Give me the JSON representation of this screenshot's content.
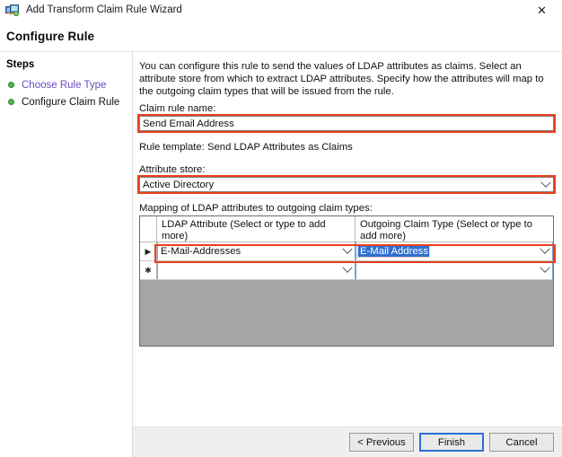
{
  "window": {
    "title": "Add Transform Claim Rule Wizard",
    "icon": "wizard-icon",
    "close_label": "✕"
  },
  "page": {
    "heading": "Configure Rule",
    "description": "You can configure this rule to send the values of LDAP attributes as claims. Select an attribute store from which to extract LDAP attributes. Specify how the attributes will map to the outgoing claim types that will be issued from the rule."
  },
  "steps": {
    "title": "Steps",
    "items": [
      {
        "label": "Choose Rule Type",
        "state": "link"
      },
      {
        "label": "Configure Claim Rule",
        "state": "current"
      }
    ]
  },
  "form": {
    "claim_rule_name_label": "Claim rule name:",
    "claim_rule_name_value": "Send Email Address",
    "claim_rule_name_placeholder": "",
    "rule_template_label": "Rule template: Send LDAP Attributes as Claims",
    "attribute_store_label": "Attribute store:",
    "attribute_store_value": "Active Directory",
    "attribute_store_options": [
      "Active Directory"
    ],
    "mapping_label": "Mapping of LDAP attributes to outgoing claim types:"
  },
  "grid": {
    "columns": [
      "LDAP Attribute (Select or type to add more)",
      "Outgoing Claim Type (Select or type to add more)"
    ],
    "rows": [
      {
        "indicator": "▶",
        "ldap_attribute": "E-Mail-Addresses",
        "outgoing_claim_type": "E-Mail Address",
        "claim_selected": true
      },
      {
        "indicator": "✱",
        "ldap_attribute": "",
        "outgoing_claim_type": "",
        "claim_selected": false
      }
    ]
  },
  "footer": {
    "previous_label": "< Previous",
    "finish_label": "Finish",
    "cancel_label": "Cancel"
  },
  "colors": {
    "highlight": "#e8401f",
    "step_bullet": "#49b749",
    "link": "#6a4bbd",
    "focus_border": "#2b6fd6",
    "selection": "#2f6fd0",
    "grid_empty": "#a6a6a6"
  }
}
